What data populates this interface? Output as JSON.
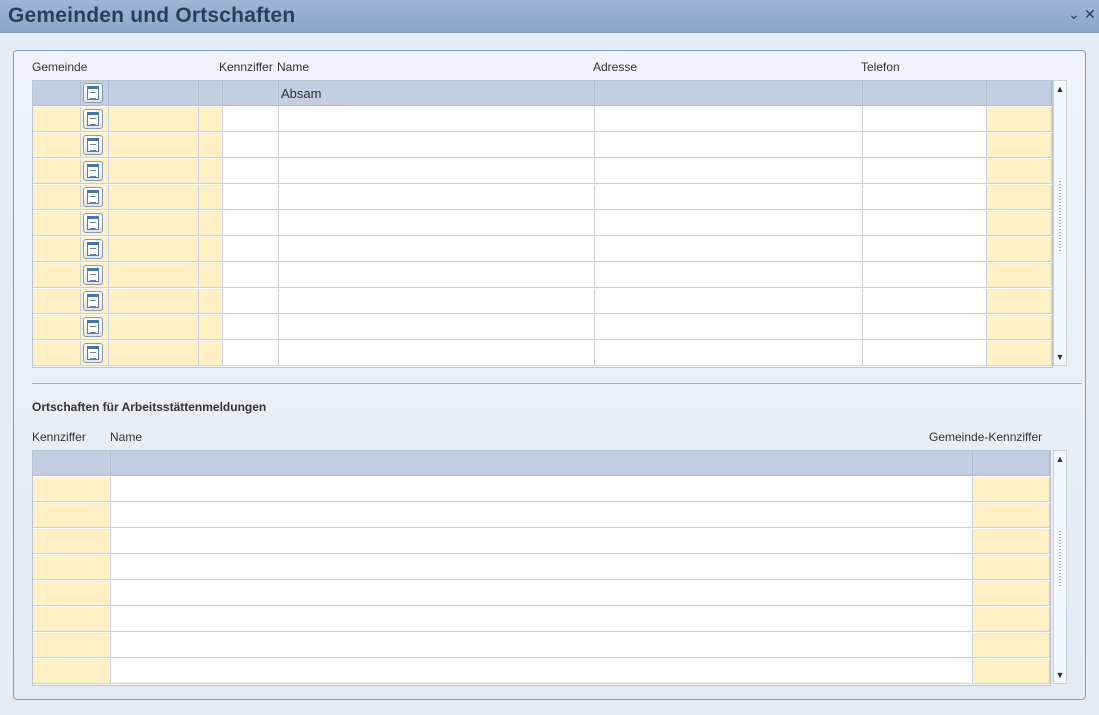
{
  "window": {
    "title": "Gemeinden und Ortschaften",
    "minimize_glyph": "⌄",
    "close_glyph": "✕"
  },
  "gemeinden_table": {
    "headers": {
      "gemeinde": "Gemeinde",
      "kennziffer": "Kennziffer",
      "name": "Name",
      "adresse": "Adresse",
      "telefon": "Telefon"
    },
    "rows": [
      {
        "name": "Absam",
        "selected": true
      },
      {
        "name": ""
      },
      {
        "name": ""
      },
      {
        "name": ""
      },
      {
        "name": ""
      },
      {
        "name": ""
      },
      {
        "name": ""
      },
      {
        "name": ""
      },
      {
        "name": ""
      },
      {
        "name": ""
      },
      {
        "name": ""
      }
    ],
    "row_icon": "document-icon"
  },
  "ortschaften_section": {
    "title": "Ortschaften für Arbeitsstättenmeldungen",
    "headers": {
      "kennziffer": "Kennziffer",
      "name": "Name",
      "gemeinde_kennziffer": "Gemeinde-Kennziffer"
    },
    "row_count": 9
  },
  "colors": {
    "titlebar": "#8aa5c6",
    "selected_row": "#c3cfe0",
    "readonly_cell": "#fff0c6"
  }
}
